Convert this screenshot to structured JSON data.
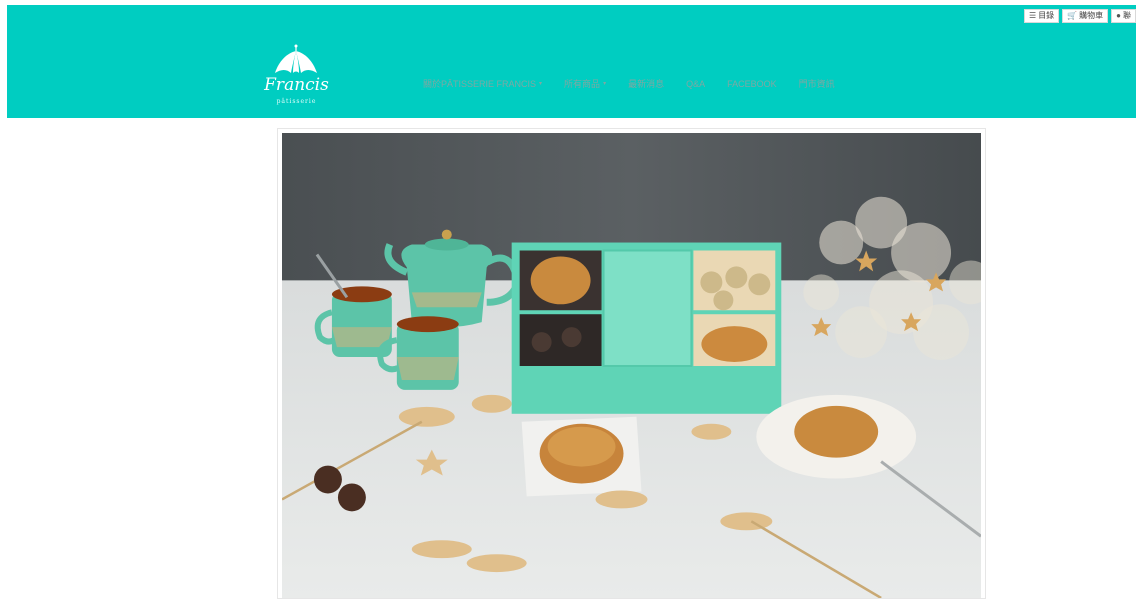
{
  "topbar": {
    "menu_label": "目錄",
    "cart_label": "購物車",
    "third_label": "聯"
  },
  "brand": {
    "name": "Francis",
    "sub": "pâtisserie"
  },
  "nav": {
    "items": [
      {
        "label": "關於PÂTISSERIE FRANCIS",
        "caret": "▾"
      },
      {
        "label": "所有商品",
        "caret": "▾"
      },
      {
        "label": "最新消息"
      },
      {
        "label": "Q&A"
      },
      {
        "label": "FACEBOOK"
      },
      {
        "label": "門市資訊"
      }
    ]
  },
  "colors": {
    "header_bg": "#00cdc1",
    "nav_text": "#7ea8a2",
    "gift_box": "#5fd4b6"
  },
  "icons": {
    "menu": "list-icon",
    "cart": "cart-icon",
    "chat": "chat-icon"
  }
}
